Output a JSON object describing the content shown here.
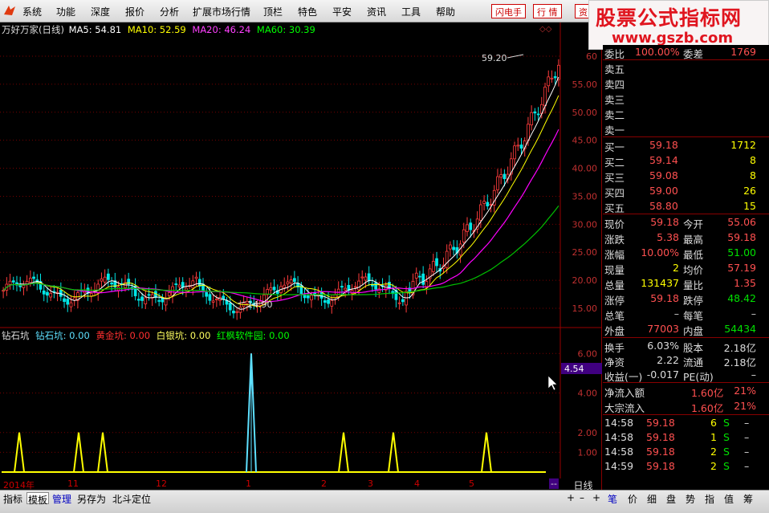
{
  "menu": {
    "items": [
      "系统",
      "功能",
      "深度",
      "报价",
      "分析",
      "扩展市场行情",
      "顶栏",
      "特色",
      "平安",
      "资讯",
      "工具",
      "帮助"
    ],
    "quick": [
      "闪电手",
      "行 情",
      "资"
    ]
  },
  "brand": {
    "title": "股票公式指标网",
    "url": "www.gszb.com"
  },
  "chart_header": {
    "name": "万好万家(日线)",
    "ma5": "MA5: 54.81",
    "ma10": "MA10: 52.59",
    "ma20": "MA20: 46.24",
    "ma60": "MA60: 30.39",
    "colors": {
      "ma5": "#ffffff",
      "ma10": "#ffff00",
      "ma20": "#ff00ff",
      "ma60": "#00ff00"
    }
  },
  "indicator_header": {
    "name": "钻石坑",
    "diamond": "钻石坑: 0.00",
    "gold": "黄金坑: 0.00",
    "silver": "白银坑: 0.00",
    "redmaple": "红枫软件园: 0.00"
  },
  "price_axis": [
    "60",
    "55.00",
    "50.00",
    "45.00",
    "40.00",
    "35.00",
    "30.00",
    "25.00",
    "20.00",
    "15.00"
  ],
  "indicator_axis": [
    "6.00",
    "4.00",
    "2.00",
    "1.00"
  ],
  "indicator_marker": "4.54",
  "annotations": {
    "high": "59.20",
    "low": "14.90"
  },
  "date_axis": [
    "2014年",
    "11",
    "12",
    "1",
    "2",
    "3",
    "4",
    "5",
    "--"
  ],
  "daily_label": "日线",
  "order_book": {
    "commission": {
      "label1": "委比",
      "value1": "100.00%",
      "label2": "委差",
      "value2": "1769"
    },
    "sell": [
      {
        "label": "卖五",
        "price": "",
        "vol": ""
      },
      {
        "label": "卖四",
        "price": "",
        "vol": ""
      },
      {
        "label": "卖三",
        "price": "",
        "vol": ""
      },
      {
        "label": "卖二",
        "price": "",
        "vol": ""
      },
      {
        "label": "卖一",
        "price": "",
        "vol": ""
      }
    ],
    "buy": [
      {
        "label": "买一",
        "price": "59.18",
        "vol": "1712"
      },
      {
        "label": "买二",
        "price": "59.14",
        "vol": "8"
      },
      {
        "label": "买三",
        "price": "59.08",
        "vol": "8"
      },
      {
        "label": "买四",
        "price": "59.00",
        "vol": "26"
      },
      {
        "label": "买五",
        "price": "58.80",
        "vol": "15"
      }
    ]
  },
  "quote": [
    {
      "l1": "现价",
      "v1": "59.18",
      "l2": "今开",
      "v2": "55.06",
      "c1": "#ff5050",
      "c2": "#ff5050"
    },
    {
      "l1": "涨跌",
      "v1": "5.38",
      "l2": "最高",
      "v2": "59.18",
      "c1": "#ff5050",
      "c2": "#ff5050"
    },
    {
      "l1": "涨幅",
      "v1": "10.00%",
      "l2": "最低",
      "v2": "51.00",
      "c1": "#ff5050",
      "c2": "#00e000"
    },
    {
      "l1": "现量",
      "v1": "2",
      "l2": "均价",
      "v2": "57.19",
      "c1": "#ffff00",
      "c2": "#ff5050"
    },
    {
      "l1": "总量",
      "v1": "131437",
      "l2": "量比",
      "v2": "1.35",
      "c1": "#ffff00",
      "c2": "#ff5050"
    },
    {
      "l1": "涨停",
      "v1": "59.18",
      "l2": "跌停",
      "v2": "48.42",
      "c1": "#ff5050",
      "c2": "#00e000"
    },
    {
      "l1": "总笔",
      "v1": "–",
      "l2": "每笔",
      "v2": "–",
      "c1": "#cccccc",
      "c2": "#cccccc"
    },
    {
      "l1": "外盘",
      "v1": "77003",
      "l2": "内盘",
      "v2": "54434",
      "c1": "#ff5050",
      "c2": "#00e000"
    }
  ],
  "fundamentals": [
    {
      "l1": "换手",
      "v1": "6.03%",
      "l2": "股本",
      "v2": "2.18亿"
    },
    {
      "l1": "净资",
      "v1": "2.22",
      "l2": "流通",
      "v2": "2.18亿"
    },
    {
      "l1": "收益(一)",
      "v1": "-0.017",
      "l2": "PE(动)",
      "v2": "–"
    }
  ],
  "flows": [
    {
      "label": "净流入额",
      "value": "1.60亿",
      "pct": "21%"
    },
    {
      "label": "大宗流入",
      "value": "1.60亿",
      "pct": "21%"
    }
  ],
  "ticks": [
    {
      "time": "14:58",
      "price": "59.18",
      "vol": "6",
      "side": "S",
      "dash": "–"
    },
    {
      "time": "14:58",
      "price": "59.18",
      "vol": "1",
      "side": "S",
      "dash": "–"
    },
    {
      "time": "14:58",
      "price": "59.18",
      "vol": "2",
      "side": "S",
      "dash": "–"
    },
    {
      "time": "14:59",
      "price": "59.18",
      "vol": "2",
      "side": "S",
      "dash": "–"
    }
  ],
  "bottom_tabs": [
    "指标",
    "模板",
    "管理",
    "另存为",
    "北斗定位"
  ],
  "right_tabs": [
    "笔",
    "价",
    "细",
    "盘",
    "势",
    "指",
    "值",
    "筹"
  ],
  "nav_controls": [
    "+",
    "–",
    "+"
  ]
}
